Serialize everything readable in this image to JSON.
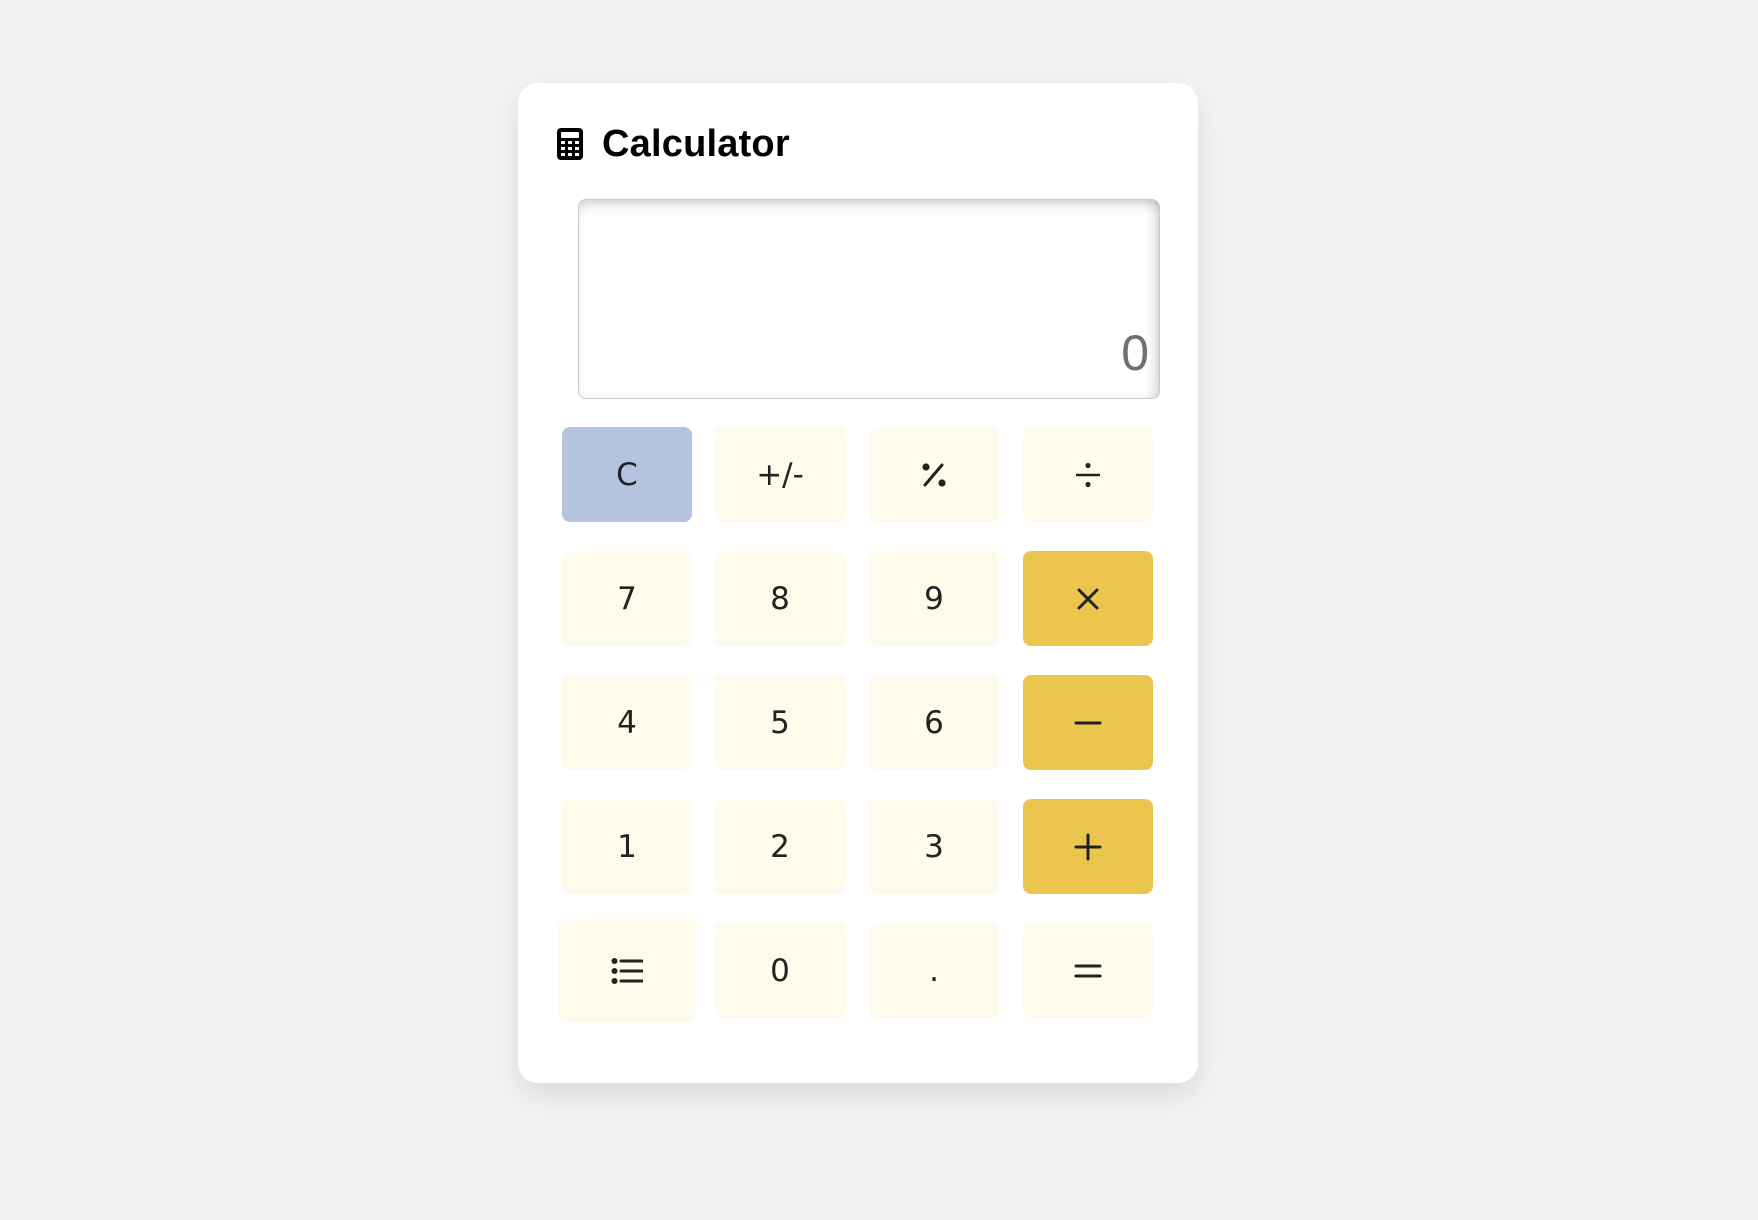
{
  "app": {
    "title": "Calculator",
    "icon": "calculator-icon"
  },
  "display": {
    "value": "0"
  },
  "colors": {
    "background": "#f3f3f3",
    "card": "#ffffff",
    "number_key": "#fffbec",
    "operator_key": "#ecc54f",
    "clear_key": "#b4c4de",
    "display_text": "#6f6f6f"
  },
  "keys": {
    "clear": {
      "label": "C"
    },
    "negate": {
      "label": "+/-"
    },
    "percent": {
      "icon": "percent-icon"
    },
    "divide": {
      "icon": "divide-icon"
    },
    "seven": {
      "label": "7"
    },
    "eight": {
      "label": "8"
    },
    "nine": {
      "label": "9"
    },
    "multiply": {
      "icon": "multiply-icon"
    },
    "four": {
      "label": "4"
    },
    "five": {
      "label": "5"
    },
    "six": {
      "label": "6"
    },
    "subtract": {
      "icon": "minus-icon"
    },
    "one": {
      "label": "1"
    },
    "two": {
      "label": "2"
    },
    "three": {
      "label": "3"
    },
    "add": {
      "icon": "plus-icon"
    },
    "history": {
      "icon": "list-icon"
    },
    "zero": {
      "label": "0"
    },
    "decimal": {
      "label": "."
    },
    "equals": {
      "icon": "equals-icon"
    }
  }
}
